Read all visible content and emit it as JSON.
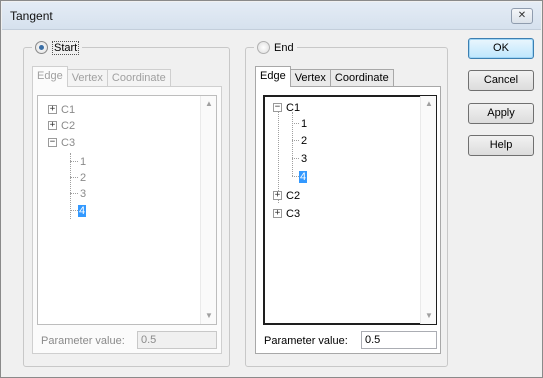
{
  "window": {
    "title": "Tangent",
    "close_glyph": "✕"
  },
  "start": {
    "label": "Start",
    "selected": true,
    "tabs": [
      "Edge",
      "Vertex",
      "Coordinate"
    ],
    "active_tab": "Edge",
    "tree": {
      "curves": [
        {
          "label": "C1",
          "expander": "+"
        },
        {
          "label": "C2",
          "expander": "+"
        },
        {
          "label": "C3",
          "expander": "−",
          "children": [
            "1",
            "2",
            "3",
            "4"
          ],
          "selected_child": "4"
        }
      ]
    },
    "param_label": "Parameter value:",
    "param_value": "0.5"
  },
  "end": {
    "label": "End",
    "selected": false,
    "tabs": [
      "Edge",
      "Vertex",
      "Coordinate"
    ],
    "active_tab": "Edge",
    "tree": {
      "curves": [
        {
          "label": "C1",
          "expander": "−",
          "children": [
            "1",
            "2",
            "3",
            "4"
          ],
          "selected_child": "4"
        },
        {
          "label": "C2",
          "expander": "+"
        },
        {
          "label": "C3",
          "expander": "+"
        }
      ]
    },
    "param_label": "Parameter value:",
    "param_value": "0.5"
  },
  "buttons": {
    "ok": "OK",
    "cancel": "Cancel",
    "apply": "Apply",
    "help": "Help"
  },
  "scroll_glyphs": {
    "up": "▲",
    "down": "▼"
  }
}
